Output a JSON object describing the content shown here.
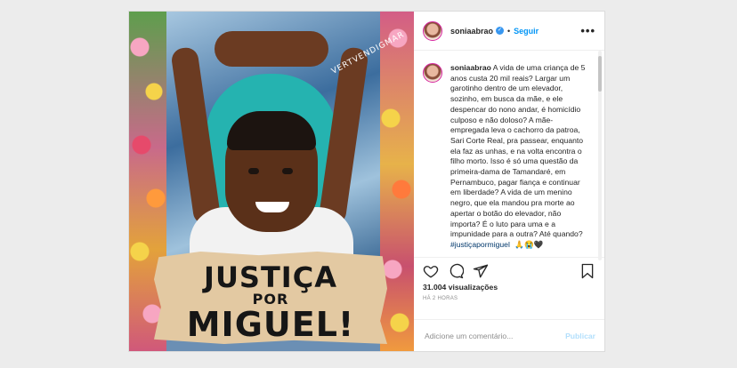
{
  "post": {
    "username": "soniaabrao",
    "follow_label": "Seguir",
    "dot": "•",
    "more_label": "•••",
    "verified_mark": "✓",
    "image": {
      "sign_line1": "JUSTIÇA",
      "sign_line2": "POR",
      "sign_line3": "MIGUEL!",
      "watermark": "VERTVENDIGMAR"
    },
    "caption": {
      "username": "soniaabrao",
      "text": "A vida de uma criança de 5 anos custa 20 mil reais? Largar um garotinho dentro de um elevador, sozinho, em busca da mãe, e ele despencar do nono andar, é homicídio culposo e não doloso? A mãe-empregada leva o cachorro da patroa, Sari Corte Real, pra passear, enquanto ela faz as unhas, e na volta encontra o filho morto. Isso é só uma questão da primeira-dama de Tamandaré, em Pernambuco, pagar fiança e continuar em liberdade? A vida de um menino negro, que ela mandou pra morte ao apertar o botão do elevador, não importa? É o luto para uma e a impunidade para a outra? Até quando?",
      "hashtag": "#justiçapormiguel",
      "emojis": "🙏😭🖤"
    },
    "views_count": "31.004",
    "views_label": "visualizações",
    "time_ago": "HÁ 2 HORAS",
    "comment_placeholder": "Adicione um comentário...",
    "publish_label": "Publicar",
    "icons": {
      "like": "heart-icon",
      "comment": "comment-icon",
      "share": "share-icon",
      "save": "bookmark-icon"
    }
  }
}
